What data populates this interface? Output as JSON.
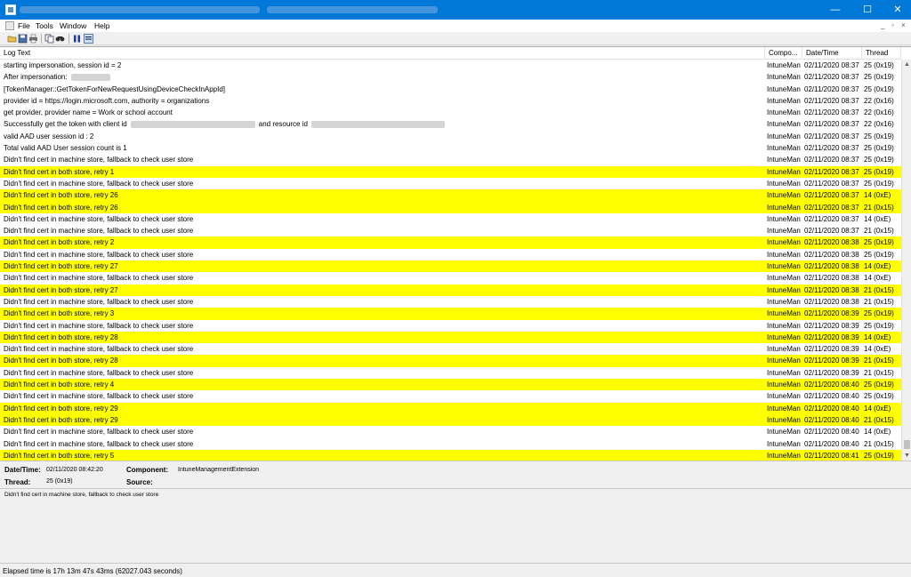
{
  "window": {
    "minimize_glyph": "—",
    "maximize_glyph": "☐",
    "close_glyph": "✕"
  },
  "menu": [
    "File",
    "Tools",
    "Window",
    "Help"
  ],
  "mdi_controls": [
    "_",
    "▫",
    "×"
  ],
  "toolbar_icons": [
    "open-icon",
    "save-icon",
    "print-icon",
    "copy-icon",
    "find-icon",
    "pause-icon",
    "highlight-icon"
  ],
  "columns": [
    "Log Text",
    "Compo...",
    "Date/Time",
    "Thread"
  ],
  "rows": [
    {
      "text": "starting impersonation, session id = 2",
      "comp": "IntuneMan",
      "dt": "02/11/2020 08:37",
      "th": "25 (0x19)",
      "hl": false
    },
    {
      "text": "After impersonation:",
      "comp": "IntuneMan",
      "dt": "02/11/2020 08:37",
      "th": "25 (0x19)",
      "hl": false,
      "redact1": 44
    },
    {
      "text": "[TokenManager::GetTokenForNewRequestUsingDeviceCheckInAppId]",
      "comp": "IntuneMan",
      "dt": "02/11/2020 08:37",
      "th": "25 (0x19)",
      "hl": false
    },
    {
      "text": "provider id = https://login.microsoft.com, authority = organizations",
      "comp": "IntuneMan",
      "dt": "02/11/2020 08:37",
      "th": "22 (0x16)",
      "hl": false
    },
    {
      "text": "get provider, provider name = Work or school account",
      "comp": "IntuneMan",
      "dt": "02/11/2020 08:37",
      "th": "22 (0x16)",
      "hl": false
    },
    {
      "text": "Successfully get the token with client id",
      "text2": "and resource id",
      "comp": "IntuneMan",
      "dt": "02/11/2020 08:37",
      "th": "22 (0x16)",
      "hl": false,
      "redact1": 140,
      "redact2": 150
    },
    {
      "text": "valid AAD user session id : 2",
      "comp": "IntuneMan",
      "dt": "02/11/2020 08:37",
      "th": "25 (0x19)",
      "hl": false
    },
    {
      "text": "Total valid AAD User session count is 1",
      "comp": "IntuneMan",
      "dt": "02/11/2020 08:37",
      "th": "25 (0x19)",
      "hl": false
    },
    {
      "text": "Didn't find cert in machine store, fallback to check user store",
      "comp": "IntuneMan",
      "dt": "02/11/2020 08:37",
      "th": "25 (0x19)",
      "hl": false
    },
    {
      "text": "Didn't find cert in both store, retry 1",
      "comp": "IntuneMan",
      "dt": "02/11/2020 08:37",
      "th": "25 (0x19)",
      "hl": true
    },
    {
      "text": "Didn't find cert in machine store, fallback to check user store",
      "comp": "IntuneMan",
      "dt": "02/11/2020 08:37",
      "th": "25 (0x19)",
      "hl": false
    },
    {
      "text": "Didn't find cert in both store, retry 26",
      "comp": "IntuneMan",
      "dt": "02/11/2020 08:37",
      "th": "14 (0xE)",
      "hl": true
    },
    {
      "text": "Didn't find cert in both store, retry 26",
      "comp": "IntuneMan",
      "dt": "02/11/2020 08:37",
      "th": "21 (0x15)",
      "hl": true
    },
    {
      "text": "Didn't find cert in machine store, fallback to check user store",
      "comp": "IntuneMan",
      "dt": "02/11/2020 08:37",
      "th": "14 (0xE)",
      "hl": false
    },
    {
      "text": "Didn't find cert in machine store, fallback to check user store",
      "comp": "IntuneMan",
      "dt": "02/11/2020 08:37",
      "th": "21 (0x15)",
      "hl": false
    },
    {
      "text": "Didn't find cert in both store, retry 2",
      "comp": "IntuneMan",
      "dt": "02/11/2020 08:38",
      "th": "25 (0x19)",
      "hl": true
    },
    {
      "text": "Didn't find cert in machine store, fallback to check user store",
      "comp": "IntuneMan",
      "dt": "02/11/2020 08:38",
      "th": "25 (0x19)",
      "hl": false
    },
    {
      "text": "Didn't find cert in both store, retry 27",
      "comp": "IntuneMan",
      "dt": "02/11/2020 08:38",
      "th": "14 (0xE)",
      "hl": true
    },
    {
      "text": "Didn't find cert in machine store, fallback to check user store",
      "comp": "IntuneMan",
      "dt": "02/11/2020 08:38",
      "th": "14 (0xE)",
      "hl": false
    },
    {
      "text": "Didn't find cert in both store, retry 27",
      "comp": "IntuneMan",
      "dt": "02/11/2020 08:38",
      "th": "21 (0x15)",
      "hl": true
    },
    {
      "text": "Didn't find cert in machine store, fallback to check user store",
      "comp": "IntuneMan",
      "dt": "02/11/2020 08:38",
      "th": "21 (0x15)",
      "hl": false
    },
    {
      "text": "Didn't find cert in both store, retry 3",
      "comp": "IntuneMan",
      "dt": "02/11/2020 08:39",
      "th": "25 (0x19)",
      "hl": true
    },
    {
      "text": "Didn't find cert in machine store, fallback to check user store",
      "comp": "IntuneMan",
      "dt": "02/11/2020 08:39",
      "th": "25 (0x19)",
      "hl": false
    },
    {
      "text": "Didn't find cert in both store, retry 28",
      "comp": "IntuneMan",
      "dt": "02/11/2020 08:39",
      "th": "14 (0xE)",
      "hl": true
    },
    {
      "text": "Didn't find cert in machine store, fallback to check user store",
      "comp": "IntuneMan",
      "dt": "02/11/2020 08:39",
      "th": "14 (0xE)",
      "hl": false
    },
    {
      "text": "Didn't find cert in both store, retry 28",
      "comp": "IntuneMan",
      "dt": "02/11/2020 08:39",
      "th": "21 (0x15)",
      "hl": true
    },
    {
      "text": "Didn't find cert in machine store, fallback to check user store",
      "comp": "IntuneMan",
      "dt": "02/11/2020 08:39",
      "th": "21 (0x15)",
      "hl": false
    },
    {
      "text": "Didn't find cert in both store, retry 4",
      "comp": "IntuneMan",
      "dt": "02/11/2020 08:40",
      "th": "25 (0x19)",
      "hl": true
    },
    {
      "text": "Didn't find cert in machine store, fallback to check user store",
      "comp": "IntuneMan",
      "dt": "02/11/2020 08:40",
      "th": "25 (0x19)",
      "hl": false
    },
    {
      "text": "Didn't find cert in both store, retry 29",
      "comp": "IntuneMan",
      "dt": "02/11/2020 08:40",
      "th": "14 (0xE)",
      "hl": true
    },
    {
      "text": "Didn't find cert in both store, retry 29",
      "comp": "IntuneMan",
      "dt": "02/11/2020 08:40",
      "th": "21 (0x15)",
      "hl": true
    },
    {
      "text": "Didn't find cert in machine store, fallback to check user store",
      "comp": "IntuneMan",
      "dt": "02/11/2020 08:40",
      "th": "14 (0xE)",
      "hl": false
    },
    {
      "text": "Didn't find cert in machine store, fallback to check user store",
      "comp": "IntuneMan",
      "dt": "02/11/2020 08:40",
      "th": "21 (0x15)",
      "hl": false
    },
    {
      "text": "Didn't find cert in both store, retry 5",
      "comp": "IntuneMan",
      "dt": "02/11/2020 08:41",
      "th": "25 (0x19)",
      "hl": true
    }
  ],
  "details": {
    "datetime_label": "Date/Time:",
    "datetime_value": "02/11/2020 08:42:20",
    "component_label": "Component:",
    "component_value": "IntuneManagementExtension",
    "thread_label": "Thread:",
    "thread_value": "25 (0x19)",
    "source_label": "Source:",
    "source_value": ""
  },
  "message": "Didn't find cert in machine store, fallback to check user store",
  "status": "Elapsed time is 17h 13m 47s 43ms (62027.043 seconds)",
  "colors": {
    "highlight": "#ffff00",
    "titlebar": "#0078d7"
  }
}
